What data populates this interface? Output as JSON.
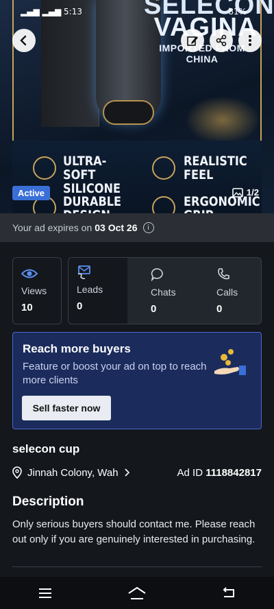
{
  "status_bar": {
    "time": "5:13",
    "battery": "81%"
  },
  "hero": {
    "title_line1": "SELECON",
    "title_line2": "VAGINA",
    "subtitle": "IMPORTED FROM CHINA",
    "features": [
      "ULTRA-SOFT SILICONE",
      "REALISTIC FEEL",
      "DURABLE DESIGN",
      "ERGONOMIC GRIP"
    ],
    "badge": "Active",
    "image_counter": "1/2"
  },
  "expiry": {
    "prefix": "Your ad expires on",
    "date": "03 Oct 26"
  },
  "stats": [
    {
      "label": "Views",
      "value": "10",
      "icon": "eye-icon"
    },
    {
      "label": "Leads",
      "value": "0",
      "icon": "leads-icon"
    },
    {
      "label": "Chats",
      "value": "0",
      "icon": "chat-icon"
    },
    {
      "label": "Calls",
      "value": "0",
      "icon": "phone-icon"
    }
  ],
  "promo": {
    "title": "Reach more buyers",
    "subtitle": "Feature or boost your ad on top to reach more clients",
    "button": "Sell faster now"
  },
  "ad": {
    "title": "selecon cup",
    "location": "Jinnah Colony, Wah",
    "ad_id_label": "Ad ID",
    "ad_id": "1118842817",
    "description_heading": "Description",
    "description": "Only serious buyers should contact me. Please reach out only if you are genuinely interested in purchasing."
  },
  "colors": {
    "accent": "#3a6fd8",
    "promo_bg": "#1b2b5c",
    "bg": "#14171c"
  }
}
